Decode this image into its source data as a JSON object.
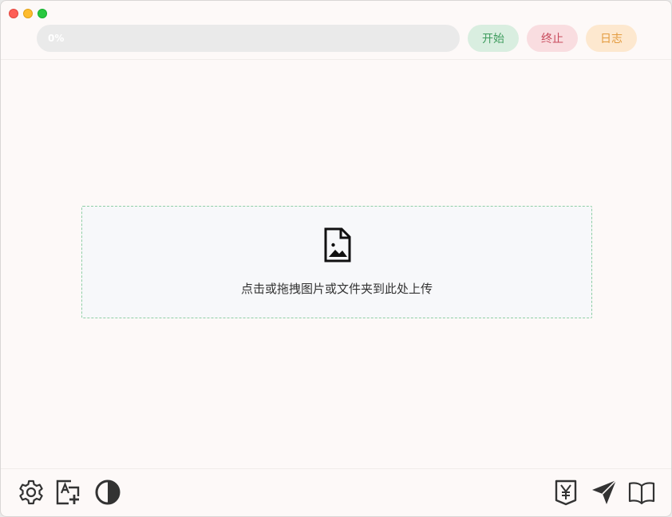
{
  "window": {
    "controls": [
      "close",
      "minimize",
      "maximize"
    ]
  },
  "toolbar": {
    "progress_percent": 0,
    "progress_label": "0%",
    "start_label": "开始",
    "stop_label": "终止",
    "log_label": "日志"
  },
  "dropzone": {
    "icon": "image-file-icon",
    "text": "点击或拖拽图片或文件夹到此处上传"
  },
  "footer": {
    "left_icons": [
      "settings-icon",
      "font-add-icon",
      "contrast-icon"
    ],
    "right_icons": [
      "yen-donate-icon",
      "send-icon",
      "book-icon"
    ]
  },
  "colors": {
    "window_bg": "#fdf9f8",
    "start_bg": "#d9eee0",
    "start_text": "#3f9c5e",
    "stop_bg": "#f9dde0",
    "stop_text": "#c84b5c",
    "log_bg": "#fde8cf",
    "log_text": "#e39b3e",
    "dropzone_border": "#8fcfa6"
  }
}
